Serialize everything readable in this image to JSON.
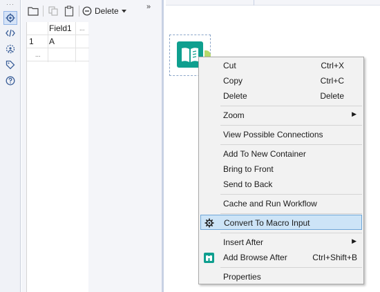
{
  "toolbar": {
    "delete_label": "Delete",
    "more_label": "»"
  },
  "grid": {
    "header": [
      "",
      "Field1",
      "..."
    ],
    "rows": [
      [
        "1",
        "A"
      ]
    ],
    "ellipsis": "..."
  },
  "rail": {
    "grip": "···"
  },
  "menu": {
    "cut": {
      "label": "Cut",
      "shortcut": "Ctrl+X"
    },
    "copy": {
      "label": "Copy",
      "shortcut": "Ctrl+C"
    },
    "delete": {
      "label": "Delete",
      "shortcut": "Delete"
    },
    "zoom": {
      "label": "Zoom"
    },
    "view_connections": {
      "label": "View Possible Connections"
    },
    "add_container": {
      "label": "Add To New Container"
    },
    "bring_front": {
      "label": "Bring to Front"
    },
    "send_back": {
      "label": "Send to Back"
    },
    "cache_run": {
      "label": "Cache and Run Workflow"
    },
    "convert_macro": {
      "label": "Convert To Macro Input"
    },
    "insert_after": {
      "label": "Insert After"
    },
    "add_browse": {
      "label": "Add Browse After",
      "shortcut": "Ctrl+Shift+B"
    },
    "properties": {
      "label": "Properties"
    }
  },
  "colors": {
    "tool": "#0f9f8f",
    "anchor": "#b5d96b",
    "highlight": "#cde4f7"
  }
}
